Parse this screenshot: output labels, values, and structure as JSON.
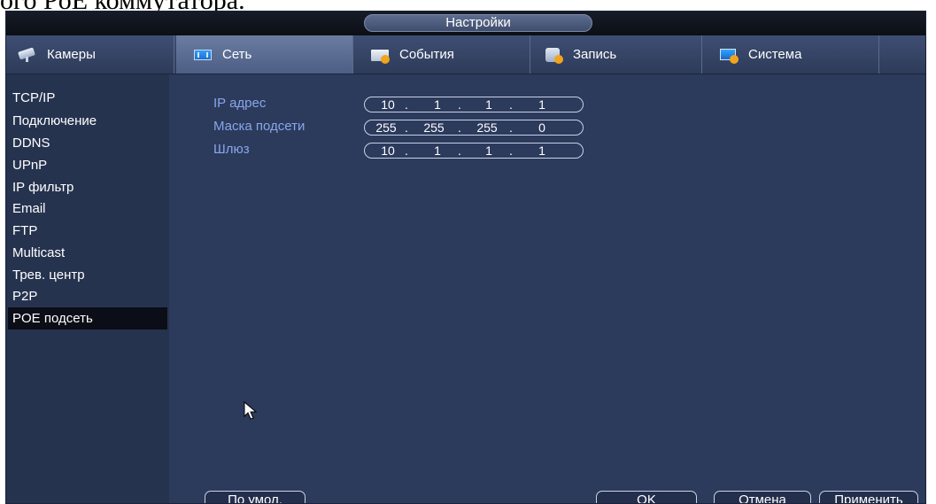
{
  "document": {
    "fragment_text": "ого PoE коммутатора."
  },
  "window": {
    "title": "Настройки"
  },
  "tabs": [
    {
      "label": "Камеры",
      "icon": "camera-icon",
      "active": false
    },
    {
      "label": "Сеть",
      "icon": "network-icon",
      "active": true
    },
    {
      "label": "События",
      "icon": "events-icon",
      "active": false
    },
    {
      "label": "Запись",
      "icon": "record-icon",
      "active": false
    },
    {
      "label": "Система",
      "icon": "system-icon",
      "active": false
    }
  ],
  "sidebar": {
    "items": [
      {
        "label": "TCP/IP"
      },
      {
        "label": "Подключение"
      },
      {
        "label": "DDNS"
      },
      {
        "label": "UPnP"
      },
      {
        "label": "IP фильтр"
      },
      {
        "label": "Email"
      },
      {
        "label": "FTP"
      },
      {
        "label": "Multicast"
      },
      {
        "label": "Трев. центр"
      },
      {
        "label": "P2P"
      },
      {
        "label": "POE подсеть",
        "active": true
      }
    ]
  },
  "form": {
    "ip": {
      "label": "IP адрес",
      "octets": [
        "10",
        "1",
        "1",
        "1"
      ]
    },
    "mask": {
      "label": "Маска подсети",
      "octets": [
        "255",
        "255",
        "255",
        "0"
      ]
    },
    "gateway": {
      "label": "Шлюз",
      "octets": [
        "10",
        "1",
        "1",
        "1"
      ]
    }
  },
  "buttons": {
    "default_label": "По умол.",
    "ok_label": "OK",
    "cancel_label": "Отмена",
    "apply_label": "Применить"
  },
  "colors": {
    "background": "#2c3a5c",
    "label_blue": "#89a6ea",
    "accent_orange": "#f2a51b"
  }
}
